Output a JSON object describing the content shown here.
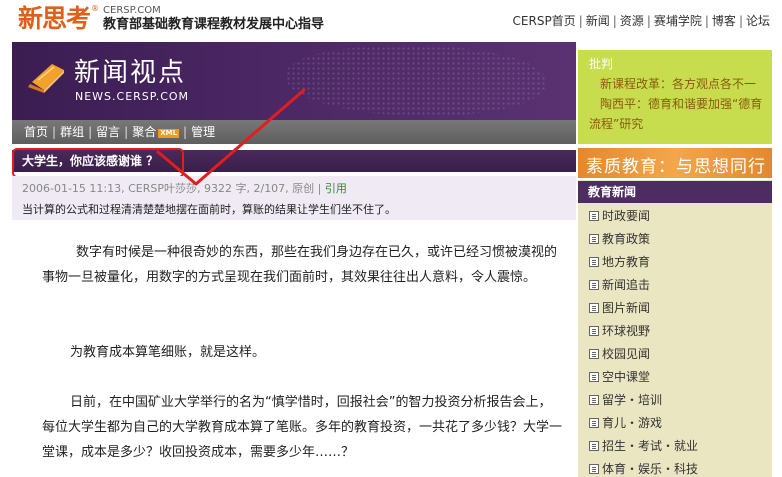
{
  "header": {
    "logo_text": "新思考",
    "logo_reg": "®",
    "logo_domain": "CERSP.COM",
    "logo_subtitle": "教育部基础教育课程教材发展中心指导",
    "nav": [
      "CERSP首页",
      "新闻",
      "资源",
      "赛埔学院",
      "博客",
      "论坛"
    ]
  },
  "banner": {
    "title": "新闻视点",
    "url": "NEWS.CERSP.COM"
  },
  "subnav": {
    "items": [
      "首页",
      "群组",
      "留言",
      "聚合",
      "管理"
    ],
    "xml_badge": "XML"
  },
  "article": {
    "title": "大学生，你应该感谢谁 ？",
    "meta_prefix": "2006-01-15 11:13, CERSP叶莎莎, 9322 字, 2/107, 原创 |",
    "meta_link": "引用",
    "summary": "当计算的公式和过程清清楚楚地摆在面前时，算账的结果让学生们坐不住了。",
    "paragraphs": [
      "数字有时候是一种很奇妙的东西，那些在我们身边存在已久，或许已经习惯被漠视的事物一旦被量化，用数字的方式呈现在我们面前时，其效果往往出人意料，令人震惊。",
      "为教育成本算笔细账，就是这样。",
      "日前，在中国矿业大学举行的名为“慎学惜时，回报社会”的智力投资分析报告会上，每位大学生都为自己的大学教育成本算了笔账。多年的教育投资，一共花了多少钱？大学一堂课，成本是多少？收回投资成本，需要多少年……？"
    ]
  },
  "right_top": {
    "label": "批判",
    "items": [
      "新课程改革：各方观点各不一",
      "陶西平：德育和谐要加强“德育流程”研究"
    ]
  },
  "right_banner": {
    "text": "素质教育：与思想同行"
  },
  "right_list": {
    "header": "教育新闻",
    "items": [
      "时政要闻",
      "教育政策",
      "地方教育",
      "新闻追击",
      "图片新闻",
      "环球视野",
      "校园见闻",
      "空中课堂",
      "留学・培训",
      "育儿・游戏",
      "招生・考试・就业",
      "体育・娱乐・科技"
    ]
  },
  "colors": {
    "logo_orange": "#e0601a",
    "banner_purple": "#4b2763",
    "right_green": "#c8dd4d",
    "annotation_red": "#e21d1d"
  }
}
